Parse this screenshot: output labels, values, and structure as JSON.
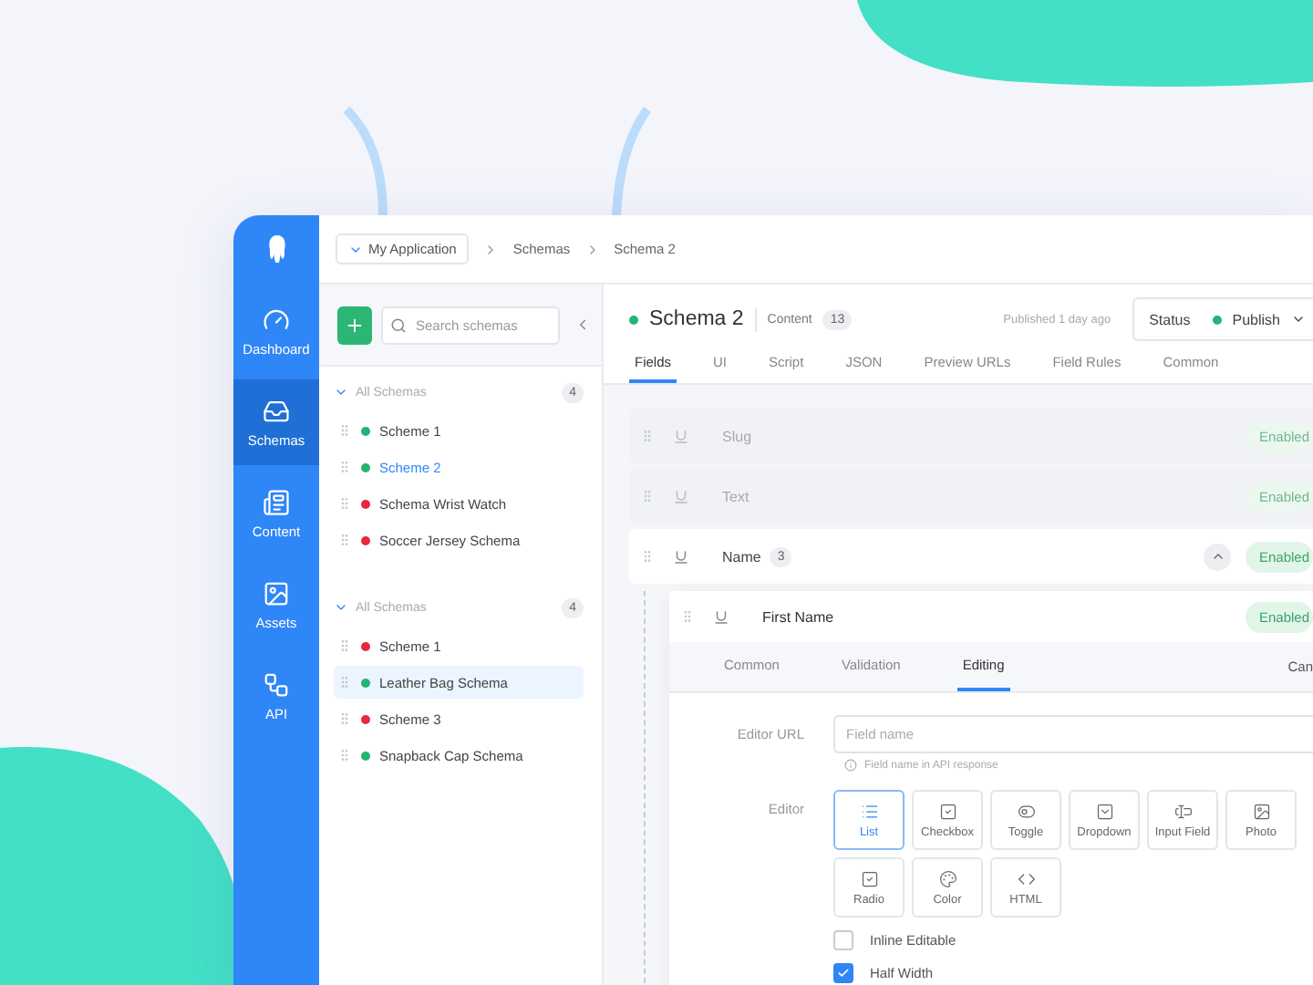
{
  "sidebar": {
    "items": [
      {
        "label": "Dashboard",
        "kind": "gauge",
        "selected": false
      },
      {
        "label": "Schemas",
        "kind": "schemas",
        "selected": true
      },
      {
        "label": "Content",
        "kind": "content",
        "selected": false
      },
      {
        "label": "Assets",
        "kind": "assets",
        "selected": false
      },
      {
        "label": "API",
        "kind": "api",
        "selected": false
      }
    ]
  },
  "breadcrumb": {
    "app": "My Application",
    "items": [
      "Schemas",
      "Schema 2"
    ]
  },
  "schema_panel": {
    "search": {
      "placeholder": "Search schemas"
    },
    "groups": [
      {
        "title": "All Schemas",
        "count": "4",
        "expanded": true,
        "items": [
          {
            "label": "Scheme 1",
            "color": "#22b573",
            "selected": false
          },
          {
            "label": "Scheme 2",
            "color": "#22b573",
            "selected": true
          },
          {
            "label": "Schema Wrist Watch",
            "color": "#e8283c",
            "selected": false
          },
          {
            "label": "Soccer Jersey Schema",
            "color": "#e8283c",
            "selected": false
          }
        ]
      },
      {
        "title": "All Schemas",
        "count": "4",
        "expanded": true,
        "items": [
          {
            "label": "Scheme 1",
            "color": "#e8283c",
            "selected": false
          },
          {
            "label": "Leather Bag Schema",
            "color": "#22b573",
            "selected": true
          },
          {
            "label": "Scheme 3",
            "color": "#e8283c",
            "selected": false
          },
          {
            "label": "Snapback Cap Schema",
            "color": "#22b573",
            "selected": false
          }
        ]
      }
    ]
  },
  "schema": {
    "title": "Schema 2",
    "color": "#22b573",
    "content_label": "Content",
    "content_count": "13",
    "published": "Published 1 day ago",
    "status": {
      "label": "Status",
      "value": "Publish",
      "color": "#22b573"
    }
  },
  "tabs": [
    {
      "label": "Fields",
      "selected": true
    },
    {
      "label": "UI",
      "selected": false
    },
    {
      "label": "Script",
      "selected": false
    },
    {
      "label": "JSON",
      "selected": false
    },
    {
      "label": "Preview URLs",
      "selected": false
    },
    {
      "label": "Field Rules",
      "selected": false
    },
    {
      "label": "Common",
      "selected": false
    }
  ],
  "fields": [
    {
      "name": "Slug",
      "badge": "Enabled",
      "disabled": true,
      "expanded": false
    },
    {
      "name": "Text",
      "badge": "Enabled",
      "disabled": true,
      "expanded": false
    },
    {
      "name": "Name",
      "count": "3",
      "badge": "Enabled",
      "disabled": false,
      "expanded": true
    }
  ],
  "nested_field": {
    "name": "First Name",
    "badge": "Enabled",
    "tabs": [
      {
        "label": "Common",
        "selected": false
      },
      {
        "label": "Validation",
        "selected": false
      },
      {
        "label": "Editing",
        "selected": true
      }
    ],
    "cancel": "Can",
    "editor_url": {
      "label": "Editor URL",
      "placeholder": "Field name",
      "hint": "Field name in API response"
    },
    "editor": {
      "label": "Editor",
      "options": [
        {
          "label": "List",
          "kind": "list",
          "selected": true
        },
        {
          "label": "Checkbox",
          "kind": "checkbox",
          "selected": false
        },
        {
          "label": "Toggle",
          "kind": "toggle",
          "selected": false
        },
        {
          "label": "Dropdown",
          "kind": "dropdown",
          "selected": false
        },
        {
          "label": "Input Field",
          "kind": "input",
          "selected": false
        },
        {
          "label": "Photo",
          "kind": "photo",
          "selected": false
        },
        {
          "label": "Radio",
          "kind": "radio",
          "selected": false
        },
        {
          "label": "Color",
          "kind": "color",
          "selected": false
        },
        {
          "label": "HTML",
          "kind": "html",
          "selected": false
        }
      ]
    },
    "checks": [
      {
        "label": "Inline Editable",
        "checked": false
      },
      {
        "label": "Half Width",
        "checked": true
      }
    ]
  }
}
